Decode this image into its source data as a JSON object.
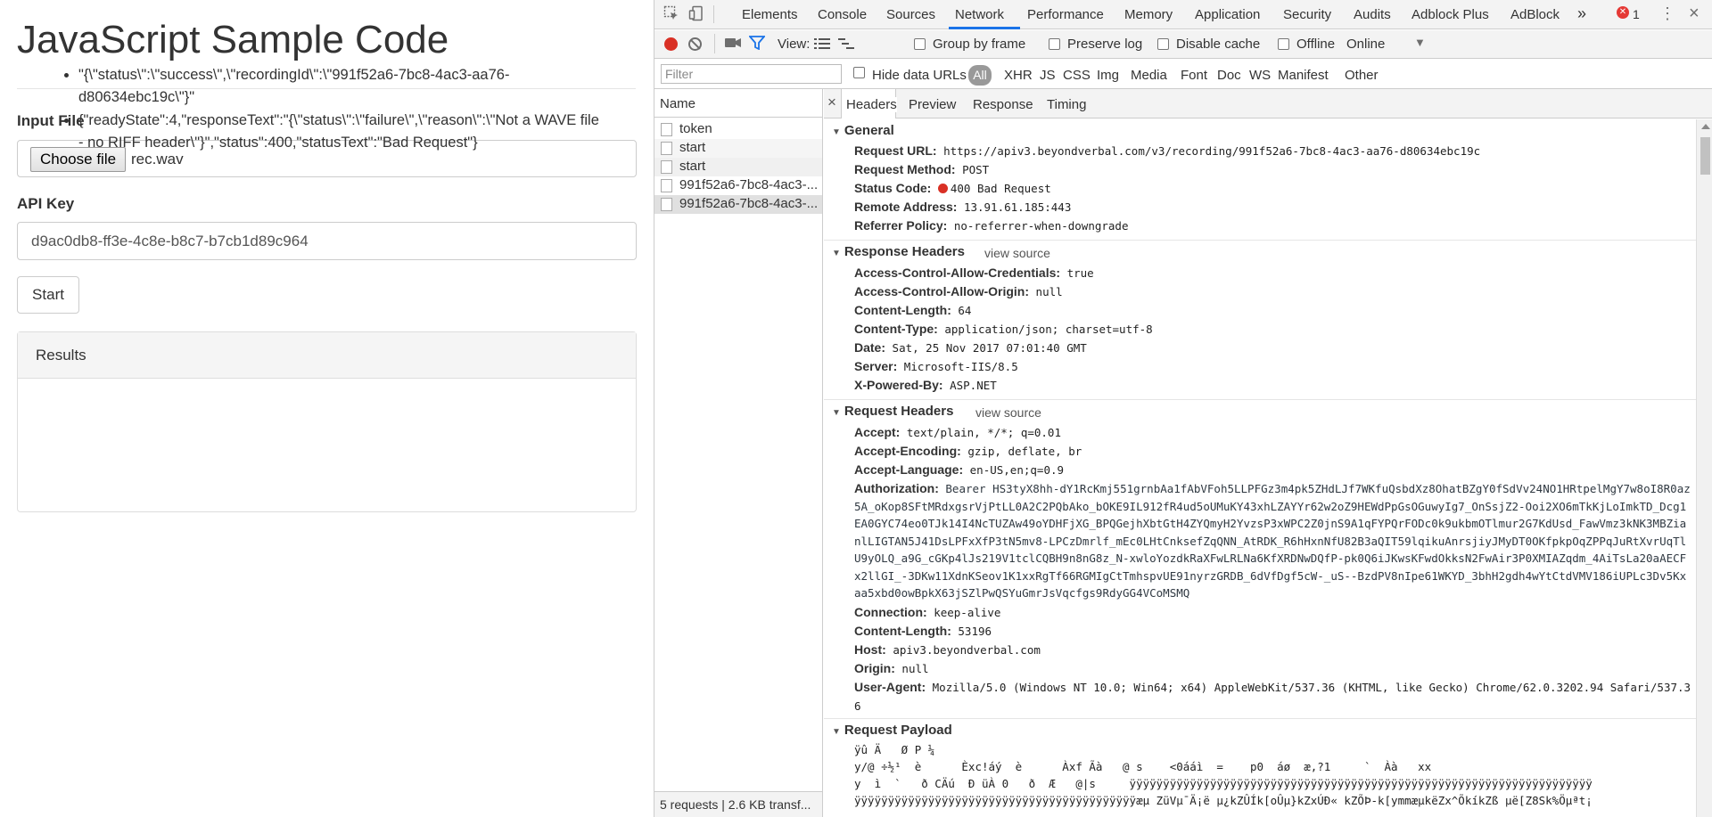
{
  "page": {
    "title": "JavaScript Sample Code",
    "input_file_label": "Input File",
    "choose_file_button": "Choose file",
    "file_name": "rec.wav",
    "api_key_label": "API Key",
    "api_key_value": "d9ac0db8-ff3e-4c8e-b8c7-b7cb1d89c964",
    "start_button": "Start",
    "results_title": "Results",
    "results": [
      "\"{\\\"status\\\":\\\"success\\\",\\\"recordingId\\\":\\\"991f52a6-7bc8-4ac3-aa76-d80634ebc19c\\\"}\"",
      "{\"readyState\":4,\"responseText\":\"{\\\"status\\\":\\\"failure\\\",\\\"reason\\\":\\\"Not a WAVE file - no RIFF header\\\"}\",\"status\":400,\"statusText\":\"Bad Request\"}"
    ]
  },
  "devtools": {
    "tabs": [
      "Elements",
      "Console",
      "Sources",
      "Network",
      "Performance",
      "Memory",
      "Application",
      "Security",
      "Audits",
      "Adblock Plus",
      "AdBlock"
    ],
    "active_tab": "Network",
    "overflow": "»",
    "error_count": "1",
    "toolbar": {
      "view_label": "View:",
      "group_by_frame": "Group by frame",
      "preserve_log": "Preserve log",
      "disable_cache": "Disable cache",
      "offline": "Offline",
      "throttle": "Online"
    },
    "filter": {
      "placeholder": "Filter",
      "hide_data_urls": "Hide data URLs",
      "types": [
        "All",
        "XHR",
        "JS",
        "CSS",
        "Img",
        "Media",
        "Font",
        "Doc",
        "WS",
        "Manifest",
        "Other"
      ]
    },
    "requests": {
      "column": "Name",
      "rows": [
        "token",
        "start",
        "start",
        "991f52a6-7bc8-4ac3-...",
        "991f52a6-7bc8-4ac3-..."
      ],
      "footer": "5 requests | 2.6 KB transf..."
    },
    "detail": {
      "close": "×",
      "tabs": [
        "Headers",
        "Preview",
        "Response",
        "Timing"
      ],
      "general_title": "General",
      "general": [
        {
          "k": "Request URL:",
          "v": "https://apiv3.beyondverbal.com/v3/recording/991f52a6-7bc8-4ac3-aa76-d80634ebc19c"
        },
        {
          "k": "Request Method:",
          "v": "POST"
        },
        {
          "k": "Status Code:",
          "v": "400 Bad Request"
        },
        {
          "k": "Remote Address:",
          "v": "13.91.61.185:443"
        },
        {
          "k": "Referrer Policy:",
          "v": "no-referrer-when-downgrade"
        }
      ],
      "response_title": "Response Headers",
      "view_source": "view source",
      "response": [
        {
          "k": "Access-Control-Allow-Credentials:",
          "v": "true"
        },
        {
          "k": "Access-Control-Allow-Origin:",
          "v": "null"
        },
        {
          "k": "Content-Length:",
          "v": "64"
        },
        {
          "k": "Content-Type:",
          "v": "application/json; charset=utf-8"
        },
        {
          "k": "Date:",
          "v": "Sat, 25 Nov 2017 07:01:40 GMT"
        },
        {
          "k": "Server:",
          "v": "Microsoft-IIS/8.5"
        },
        {
          "k": "X-Powered-By:",
          "v": "ASP.NET"
        }
      ],
      "request_title": "Request Headers",
      "request_top": [
        {
          "k": "Accept:",
          "v": "text/plain, */*; q=0.01"
        },
        {
          "k": "Accept-Encoding:",
          "v": "gzip, deflate, br"
        },
        {
          "k": "Accept-Language:",
          "v": "en-US,en;q=0.9"
        }
      ],
      "authorization_key": "Authorization:",
      "authorization_value": "Bearer HS3tyX8hh-dY1RcKmj551grnbAa1fAbVFoh5LLPFGz3m4pk5ZHdLJf7WKfuQsbdXz8OhatBZgY0fSdVv24NO1HRtpelMgY7w8oI8R0az5A_oKop8SFtMRdxgsrVjPtLL0A2C2PQbAko_bOKE9IL912fR4ud5oUMuKY43xhLZAYYr62w2oZ9HEWdPpGsOGuwyIg7_OnSsjZ2-Ooi2XO6mTkKjLoImkTD_Dcg1EA0GYC74eo0TJk14I4NcTUZAw49oYDHFjXG_BPQGejhXbtGtH4ZYQmyH2YvzsP3xWPC2Z0jnS9A1qFYPQrFODc0k9ukbmOTlmur2G7KdUsd_FawVmz3kNK3MBZianlLIGTAN5J41DsLPFxXfP3tN5mv8-LPCzDmrlf_mEc0LHtCnksefZqQNN_AtRDK_R6hHxnNfU82B3aQIT59lqikuAnrsjiyJMyDT0OKfpkpOqZPPqJuRtXvrUqTlU9yOLQ_a9G_cGKp4lJs219V1tclCQBH9n8nG8z_N-xwloYozdkRaXFwLRLNa6KfXRDNwDQfP-pk0Q6iJKwsKFwdOkksN2FwAir3P0XMIAZqdm_4AiTsLa20aAECFx2llGI_-3DKw11XdnKSeov1K1xxRgTf66RGMIgCtTmhspvUE91nyrzGRDB_6dVfDgf5cW-_uS--BzdPV8nIpe61WKYD_3bhH2gdh4wYtCtdVMV186iUPLc3Dv5Kxaa5xbd0owBpkX63jSZlPwQSYuGmrJsVqcfgs9RdyGG4VCoMSMQ",
      "request_bottom": [
        {
          "k": "Connection:",
          "v": "keep-alive"
        },
        {
          "k": "Content-Length:",
          "v": "53196"
        },
        {
          "k": "Host:",
          "v": "apiv3.beyondverbal.com"
        },
        {
          "k": "Origin:",
          "v": "null"
        },
        {
          "k": "User-Agent:",
          "v": "Mozilla/5.0 (Windows NT 10.0; Win64; x64) AppleWebKit/537.36 (KHTML, like Gecko) Chrome/62.0.3202.94 Safari/537.36"
        }
      ],
      "payload_title": "Request Payload",
      "payload_lines": [
        "ÿû Ä   Ø P ¼",
        "y/@ ÷½¹  è      Èxc!áý  è      Àxf Ãà   @ s    <0ááì  =    p0  áø  æ,?1     `  Àà   xx",
        "y  ì  `   ð CÄú  Ð üÀ 0   ð  Æ   @|s     ÿÿÿÿÿÿÿÿÿÿÿÿÿÿÿÿÿÿÿÿÿÿÿÿÿÿÿÿÿÿÿÿÿÿÿÿÿÿÿÿÿÿÿÿÿÿÿÿÿÿÿÿÿÿÿÿÿÿÿÿÿÿÿÿÿÿÿÿÿ",
        "ÿÿÿÿÿÿÿÿÿÿÿÿÿÿÿÿÿÿÿÿÿÿÿÿÿÿÿÿÿÿÿÿÿÿÿÿÿÿÿÿÿÿæµ ZüVµ¯Ä¡ë µ¿kZÛÍk[oÛµ}kZxÚÐ« kZÕÞ-k[ymmæµkëZx^ÕkíkZß µë[Z8Sk%Öµªt¡"
      ]
    }
  }
}
